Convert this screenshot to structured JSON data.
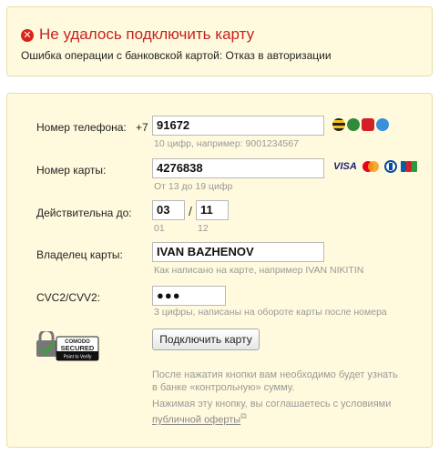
{
  "error": {
    "title": "Не удалось подключить карту",
    "detail": "Ошибка операции с банковской картой: Отказ в авторизации"
  },
  "form": {
    "phone": {
      "label": "Номер телефона:",
      "prefix": "+7",
      "value": "91672",
      "hint": "10 цифр, например: 9001234567",
      "operator_icons": [
        "beeline-icon",
        "megafon-icon",
        "mts-icon",
        "tele2-icon"
      ]
    },
    "card_number": {
      "label": "Номер карты:",
      "value": "4276838",
      "hint": "От 13 до 19 цифр",
      "brands": [
        "VISA",
        "MasterCard",
        "Diners",
        "JCB"
      ]
    },
    "expiry": {
      "label": "Действительна до:",
      "month": "03",
      "year": "11",
      "separator": "/",
      "month_hint": "01",
      "year_hint": "12"
    },
    "holder": {
      "label": "Владелец карты:",
      "value": "IVAN BAZHENOV",
      "hint": "Как написано на карте, например IVAN NIKITIN"
    },
    "cvc": {
      "label": "CVC2/CVV2:",
      "value": "●●●",
      "hint": "3 цифры, написаны на обороте карты после номера"
    },
    "submit_label": "Подключить карту",
    "badge": {
      "line1": "COMODO",
      "line2": "SECURED",
      "line3": "Point to Verify"
    },
    "note1_line1": "После нажатия кнопки вам необходимо будет узнать",
    "note1_line2": "в банке «контрольную» сумму.",
    "note2_line1": "Нажимая эту кнопку, вы соглашаетесь с условиями",
    "note2_link": "публичной оферты"
  },
  "colors": {
    "panel_bg": "#fffadd",
    "error_red": "#c62222"
  }
}
